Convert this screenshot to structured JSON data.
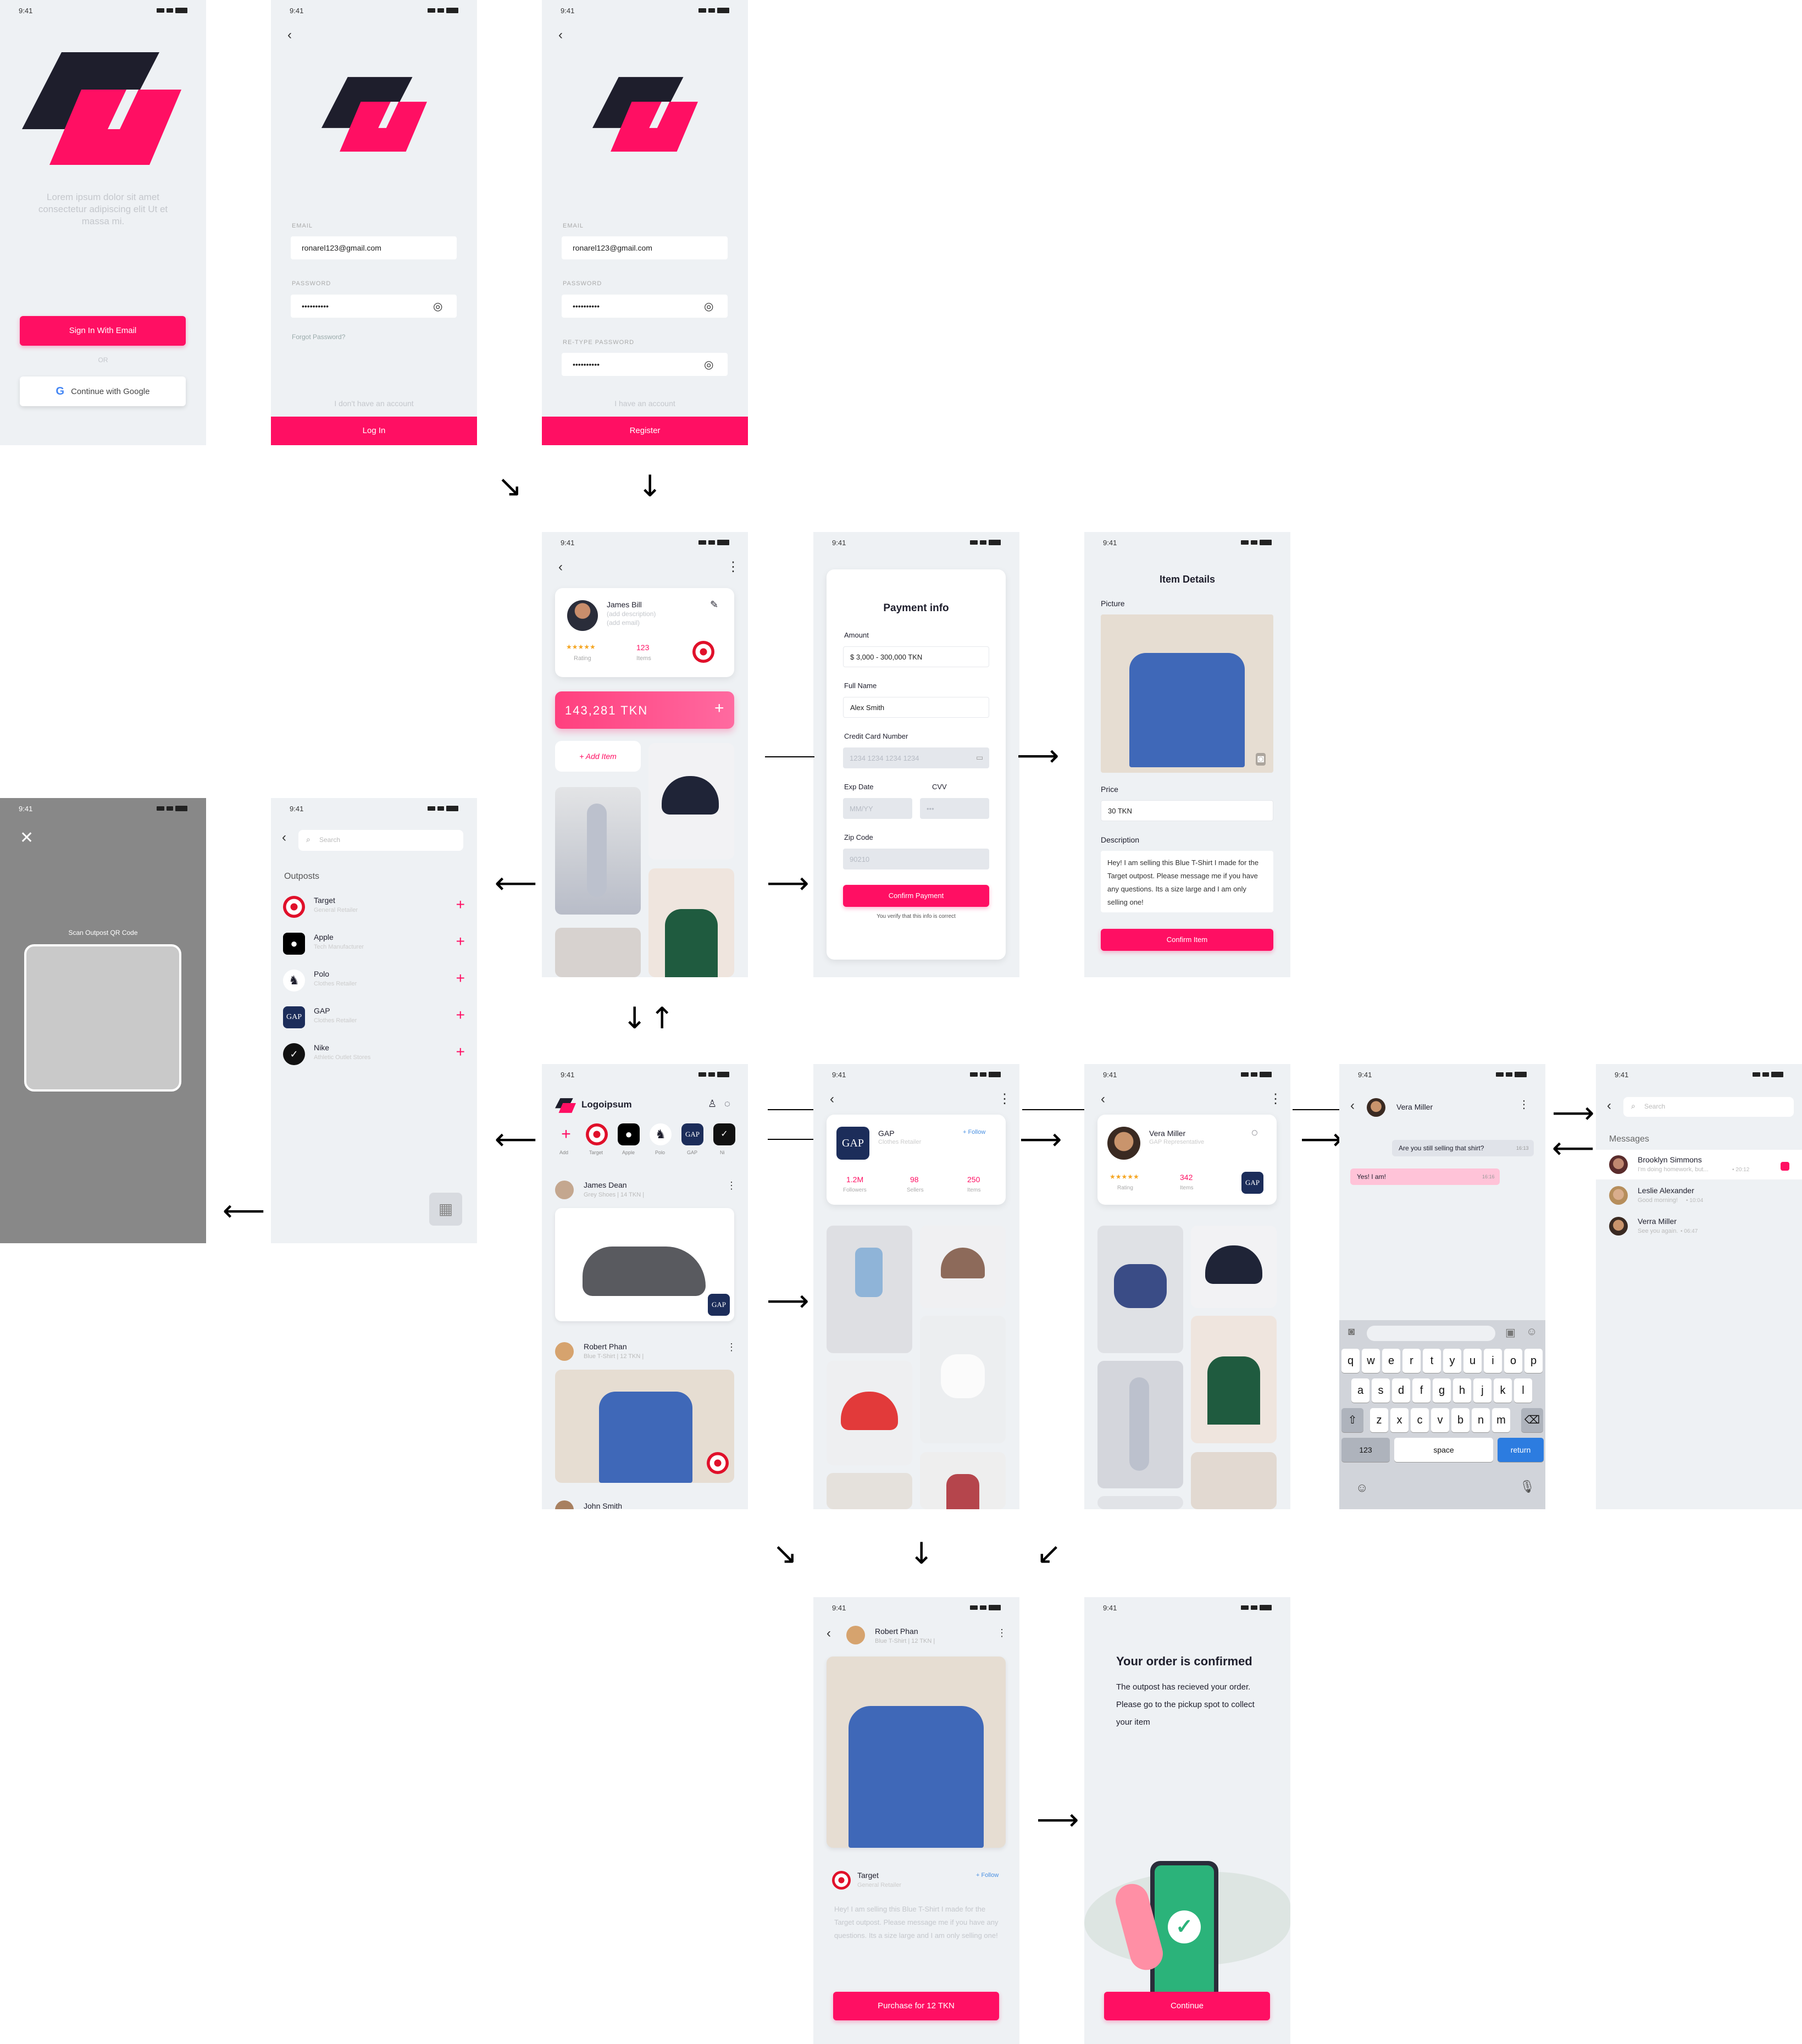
{
  "status": {
    "time": "9:41"
  },
  "s1": {
    "tagline": "Lorem ipsum dolor sit amet consectetur adipiscing elit Ut et massa mi.",
    "sign_in": "Sign In With Email",
    "or": "OR",
    "google": "Continue with Google"
  },
  "s2": {
    "email_label": "EMAIL",
    "email": "ronarel123@gmail.com",
    "password_label": "PASSWORD",
    "password": "••••••••••",
    "forgot": "Forgot Password?",
    "no_account": "I don't have an account",
    "login": "Log In"
  },
  "s3": {
    "email_label": "EMAIL",
    "email": "ronarel123@gmail.com",
    "password_label": "PASSWORD",
    "password": "••••••••••",
    "retype_label": "RE-TYPE PASSWORD",
    "retype": "••••••••••",
    "have_account": "I have an account",
    "register": "Register"
  },
  "profile": {
    "name": "James Bill",
    "desc": "(add description)",
    "email": "(add email)",
    "stars": "★★★★★",
    "rating_label": "Rating",
    "items_count": "123",
    "items_label": "Items",
    "balance": "143,281 TKN",
    "add_item": "+ Add Item"
  },
  "payment": {
    "title": "Payment info",
    "amount_label": "Amount",
    "amount": "$ 3,000 - 300,000 TKN",
    "name_label": "Full Name",
    "name": "Alex Smith",
    "cc_label": "Credit Card Number",
    "cc": "1234 1234 1234 1234",
    "exp_label": "Exp Date",
    "exp": "MM/YY",
    "cvv_label": "CVV",
    "cvv": "•••",
    "zip_label": "Zip Code",
    "zip": "90210",
    "confirm": "Confirm Payment",
    "verify": "You verify that this info is correct"
  },
  "item_details": {
    "title": "Item Details",
    "picture_label": "Picture",
    "price_label": "Price",
    "price": "30 TKN",
    "desc_label": "Description",
    "desc": "Hey! I am selling this Blue T-Shirt I made for the Target outpost. Please message me if you have any questions. Its a size large and I am only selling one!",
    "confirm": "Confirm Item"
  },
  "outposts": {
    "search": "Search",
    "title": "Outposts",
    "items": [
      {
        "name": "Target",
        "sub": "General Retailer"
      },
      {
        "name": "Apple",
        "sub": "Tech Manufacturer"
      },
      {
        "name": "Polo",
        "sub": "Clothes Retailer"
      },
      {
        "name": "GAP",
        "sub": "Clothes Retailer"
      },
      {
        "name": "Nike",
        "sub": "Athletic Outlet Stores"
      }
    ]
  },
  "scan": {
    "label": "Scan Outpost QR Code"
  },
  "feed": {
    "logo": "Logoipsum",
    "stories": [
      "Add",
      "Target",
      "Apple",
      "Polo",
      "GAP",
      "Ni"
    ],
    "post1_name": "James Dean",
    "post1_sub": "Grey Shoes | 14 TKN |",
    "post2_name": "Robert Phan",
    "post2_sub": "Blue T-Shirt | 12 TKN |",
    "post3_name": "John Smith"
  },
  "gap": {
    "name": "GAP",
    "sub": "Clothes Retailer",
    "follow": "+ Follow",
    "followers": "1.2M",
    "followers_label": "Followers",
    "sellers": "98",
    "sellers_label": "Sellers",
    "items": "250",
    "items_label": "Items"
  },
  "vera": {
    "name": "Vera Miller",
    "sub": "GAP Representative",
    "stars": "★★★★★",
    "rating_label": "Rating",
    "items": "342",
    "items_label": "Items"
  },
  "chat": {
    "name": "Vera Miller",
    "msg1": "Are you still selling that shirt?",
    "t1": "16:13",
    "msg2": "Yes! I am!",
    "t2": "16:16",
    "keys1": [
      "q",
      "w",
      "e",
      "r",
      "t",
      "y",
      "u",
      "i",
      "o",
      "p"
    ],
    "keys2": [
      "a",
      "s",
      "d",
      "f",
      "g",
      "h",
      "j",
      "k",
      "l"
    ],
    "keys3": [
      "z",
      "x",
      "c",
      "v",
      "b",
      "n",
      "m"
    ],
    "num": "123",
    "space": "space",
    "return": "return"
  },
  "messages": {
    "search": "Search",
    "title": "Messages",
    "items": [
      {
        "name": "Brooklyn Simmons",
        "preview": "I'm doing homework, but...",
        "time": "• 20:12"
      },
      {
        "name": "Leslie Alexander",
        "preview": "Good morning!",
        "time": "• 10:04"
      },
      {
        "name": "Verra Miller",
        "preview": "See you again.",
        "time": "• 06:47"
      }
    ]
  },
  "detail": {
    "name": "Robert Phan",
    "sub": "Blue T-Shirt | 12 TKN |",
    "store": "Target",
    "store_sub": "General Retailer",
    "follow": "+ Follow",
    "desc": "Hey! I am selling this Blue T-Shirt I made for the Target outpost. Please message me if you have any questions. Its a size large and I am only selling one!",
    "purchase": "Purchase for 12 TKN"
  },
  "confirmed": {
    "title": "Your order is confirmed",
    "body": "The outpost has recieved your order. Please go to the pickup spot to collect your item",
    "continue": "Continue"
  },
  "colors": {
    "accent": "#ff0f63",
    "dark": "#1e1e2c",
    "bg": "#eef1f4"
  }
}
